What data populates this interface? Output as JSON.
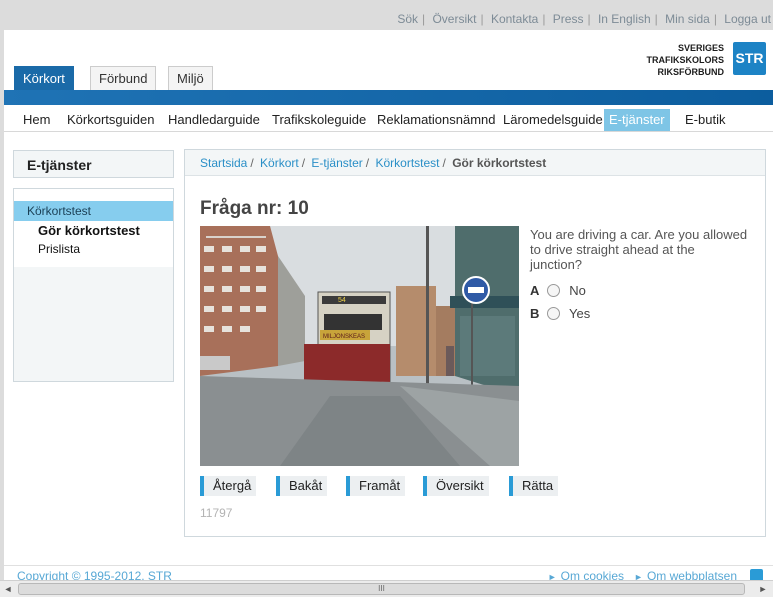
{
  "toplinks": [
    "Sök",
    "Översikt",
    "Kontakta",
    "Press",
    "In English",
    "Min sida",
    "Logga ut"
  ],
  "logo": {
    "line1": "SVERIGES",
    "line2": "TRAFIKSKOLORS",
    "line3": "RIKSFÖRBUND",
    "mark": "STR"
  },
  "tabs": [
    {
      "label": "Körkort",
      "active": true
    },
    {
      "label": "Förbund"
    },
    {
      "label": "Miljö"
    }
  ],
  "nav": [
    "Hem",
    "Körkortsguiden",
    "Handledarguide",
    "Trafikskoleguide",
    "Reklamationsnämnd",
    "Läromedelsguide",
    "E-tjänster",
    "E-butik"
  ],
  "nav_active": "E-tjänster",
  "sidebar": {
    "title": "E-tjänster",
    "selected": "Körkortstest",
    "items": [
      "Gör körkortstest",
      "Prislista"
    ]
  },
  "breadcrumb": {
    "links": [
      "Startsida",
      "Körkort",
      "E-tjänster",
      "Körkortstest"
    ],
    "current": "Gör körkortstest"
  },
  "question": {
    "title": "Fråga nr: 10",
    "text": "You are driving a car. Are you allowed to drive straight ahead at the junction?",
    "options": [
      {
        "letter": "A",
        "label": "No"
      },
      {
        "letter": "B",
        "label": "Yes"
      }
    ],
    "photo_bus_number": "54",
    "photo_bus_sign": "MILJONSKEAS",
    "id": "11797"
  },
  "buttons": [
    "Återgå",
    "Bakåt",
    "Framåt",
    "Översikt",
    "Rätta"
  ],
  "footer": {
    "copyright": "Copyright © 1995-2012, STR",
    "links": [
      "Om cookies",
      "Om webbplatsen"
    ]
  },
  "scrollbar": {
    "grip": "III"
  },
  "colors": {
    "brand_blue": "#1a6aa8",
    "link_blue": "#2a8fc7",
    "nav_active": "#7ec5e6"
  }
}
